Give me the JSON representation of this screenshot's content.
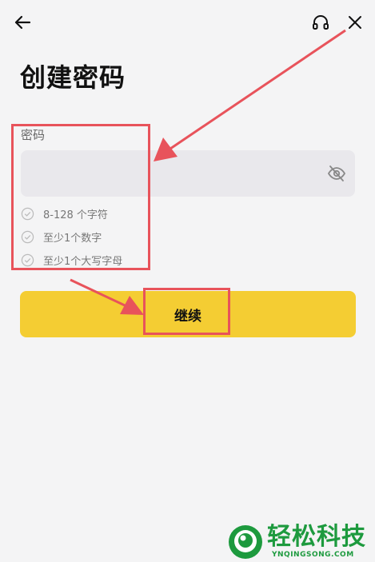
{
  "header": {
    "back_icon": "arrow-left-icon",
    "support_icon": "headset-icon",
    "close_icon": "close-icon"
  },
  "page": {
    "title": "创建密码"
  },
  "password": {
    "label": "密码",
    "value": "",
    "visibility_icon": "eye-off-icon"
  },
  "rules": [
    {
      "text": "8-128 个字符",
      "icon": "check-circle-icon"
    },
    {
      "text": "至少1个数字",
      "icon": "check-circle-icon"
    },
    {
      "text": "至少1个大写字母",
      "icon": "check-circle-icon"
    }
  ],
  "actions": {
    "continue_label": "继续"
  },
  "watermark": {
    "brand": "轻松科技",
    "domain": "YNQINGSONG.COM"
  },
  "colors": {
    "background": "#f4f4f5",
    "primary_button": "#f4cd33",
    "input_background": "#e9e8ec",
    "annotation": "#e8535b",
    "watermark": "#1d9a3e"
  }
}
